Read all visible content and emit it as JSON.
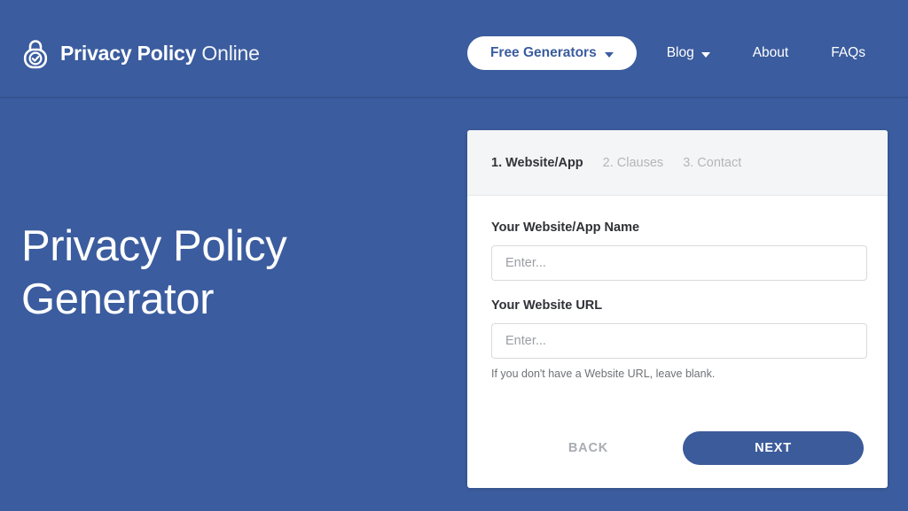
{
  "theme": {
    "brand_blue": "#3b5c9e",
    "button_blue": "#3c5b9b",
    "card_bg": "#ffffff",
    "step_header_bg": "#f4f5f6",
    "muted_text": "#b3b6bb"
  },
  "header": {
    "logo_icon": "padlock-check-icon",
    "brand_strong": "Privacy Policy",
    "brand_light": "Online",
    "nav": {
      "primary_button": {
        "label": "Free Generators",
        "icon": "chevron-down-icon"
      },
      "links": [
        {
          "label": "Blog",
          "icon": "chevron-down-icon",
          "has_caret": true
        },
        {
          "label": "About",
          "has_caret": false
        },
        {
          "label": "FAQs",
          "has_caret": false
        }
      ]
    }
  },
  "hero": {
    "title_line1": "Privacy Policy",
    "title_line2": "Generator"
  },
  "wizard": {
    "steps": [
      {
        "label": "1. Website/App",
        "state": "active"
      },
      {
        "label": "2. Clauses",
        "state": "muted"
      },
      {
        "label": "3. Contact",
        "state": "muted"
      }
    ],
    "fields": [
      {
        "label": "Your Website/App Name",
        "value": "",
        "placeholder": "Enter..."
      },
      {
        "label": "Your Website URL",
        "value": "",
        "placeholder": "Enter...",
        "helper": "If you don't have a Website URL, leave blank."
      }
    ],
    "actions": {
      "back_label": "BACK",
      "next_label": "NEXT"
    }
  }
}
